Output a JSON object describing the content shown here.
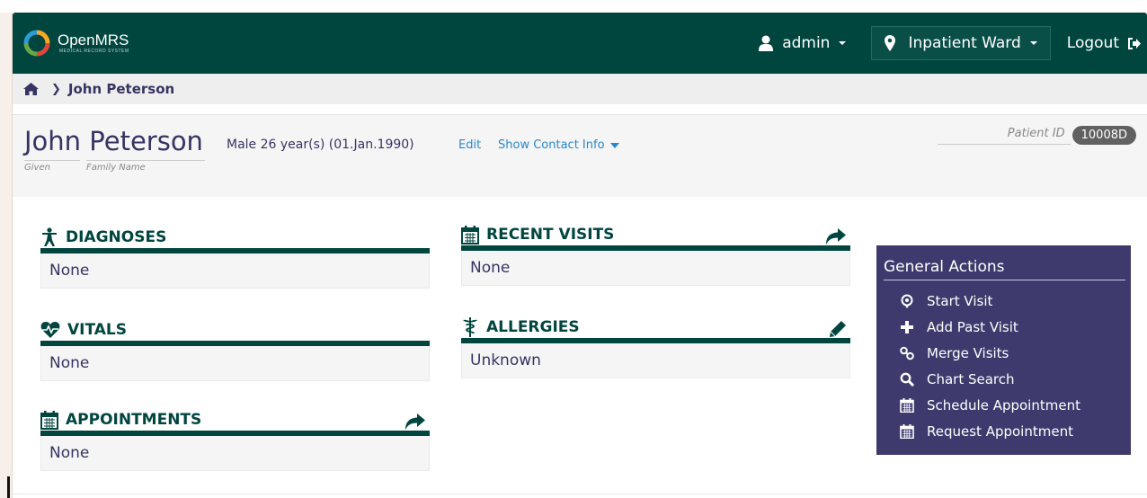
{
  "header": {
    "app_name": "OpenMRS",
    "app_tagline": "MEDICAL RECORD SYSTEM",
    "user": "admin",
    "location": "Inpatient Ward",
    "logout": "Logout",
    "brand_color": "#00463f"
  },
  "breadcrumb": {
    "current": "John Peterson"
  },
  "patient": {
    "name": "John Peterson",
    "given_label": "Given",
    "family_label": "Family Name",
    "info": "Male  26 year(s) (01.Jan.1990)",
    "edit": "Edit",
    "contact": "Show Contact Info",
    "id_label": "Patient ID",
    "id_value": "10008D"
  },
  "widgets": {
    "diagnoses": {
      "title": "DIAGNOSES",
      "value": "None"
    },
    "vitals": {
      "title": "VITALS",
      "value": "None"
    },
    "appointments": {
      "title": "APPOINTMENTS",
      "value": "None"
    },
    "recent_visits": {
      "title": "RECENT VISITS",
      "value": "None"
    },
    "allergies": {
      "title": "ALLERGIES",
      "value": "Unknown"
    }
  },
  "general_actions": {
    "title": "General Actions",
    "items": [
      {
        "label": "Start Visit",
        "icon": "map-pin-icon"
      },
      {
        "label": "Add Past Visit",
        "icon": "plus-icon"
      },
      {
        "label": "Merge Visits",
        "icon": "merge-icon"
      },
      {
        "label": "Chart Search",
        "icon": "search-icon"
      },
      {
        "label": "Schedule Appointment",
        "icon": "calendar-icon"
      },
      {
        "label": "Request Appointment",
        "icon": "calendar-icon"
      }
    ],
    "panel_color": "#3e3a6d"
  }
}
